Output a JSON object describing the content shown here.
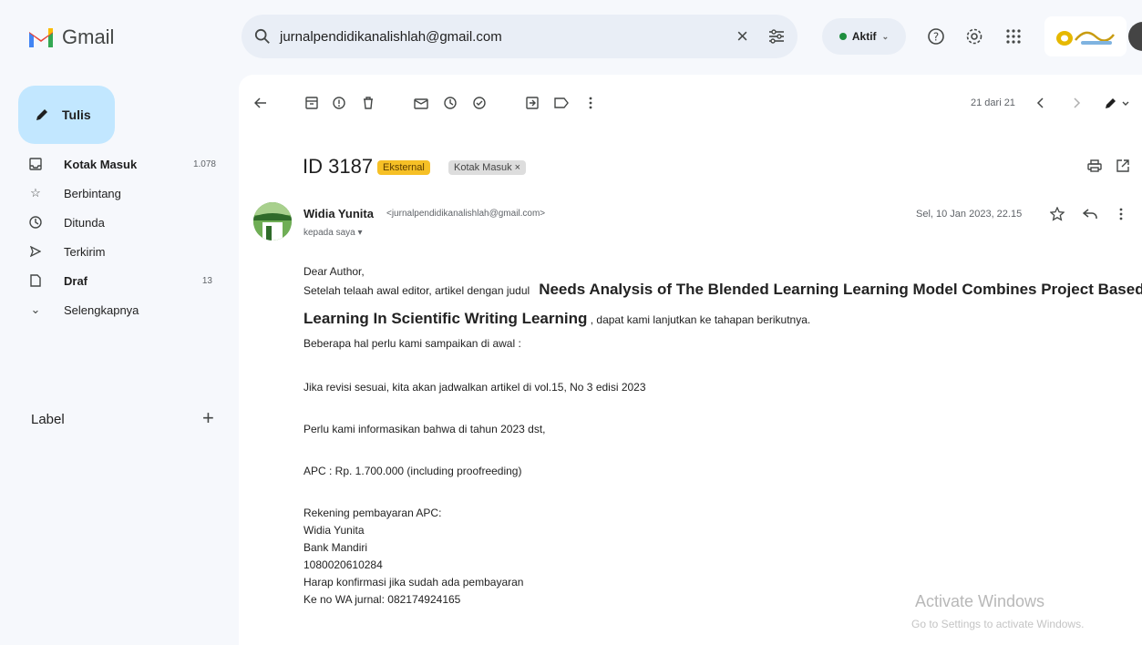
{
  "app": {
    "name": "Gmail"
  },
  "search": {
    "value": "jurnalpendidikanalishlah@gmail.com"
  },
  "status": {
    "label": "Aktif"
  },
  "compose": {
    "label": "Tulis"
  },
  "sidebar": {
    "items": [
      {
        "label": "Kotak Masuk",
        "count": "1.078"
      },
      {
        "label": "Berbintang",
        "count": ""
      },
      {
        "label": "Ditunda",
        "count": ""
      },
      {
        "label": "Terkirim",
        "count": ""
      },
      {
        "label": "Draf",
        "count": "13"
      },
      {
        "label": "Selengkapnya",
        "count": ""
      }
    ],
    "label_heading": "Label"
  },
  "toolbar": {
    "pager": "21 dari 21"
  },
  "email": {
    "subject": "ID 3187",
    "chips": {
      "external": "Eksternal",
      "inbox": "Kotak Masuk ×"
    },
    "sender_name": "Widia Yunita",
    "sender_email": "<jurnalpendidikanalishlah@gmail.com>",
    "to": "kepada saya ▾",
    "date": "Sel, 10 Jan 2023, 22.15",
    "body": {
      "greeting": "Dear Author,",
      "line1_prefix": "Setelah telaah awal editor, artikel dengan judul",
      "title_part1": "Needs Analysis  of The Blended Learning Learning Model Combines Project Based",
      "title_part2": "Learning In Scientific Writing Learning",
      "line2_suffix": ",  dapat kami lanjutkan ke tahapan berikutnya.",
      "line3": "Beberapa hal perlu kami sampaikan di awal :",
      "line4": "Jika revisi sesuai, kita akan jadwalkan artikel  di vol.15, No 3 edisi   2023",
      "line5": "Perlu kami informasikan bahwa di tahun 2023 dst,",
      "line6": "APC  : Rp. 1.700.000 (including proofreeding)",
      "line7": "Rekening pembayaran APC:",
      "line8": "Widia Yunita",
      "line9": "Bank Mandiri",
      "line10": "1080020610284",
      "line11": "Harap konfirmasi jika sudah ada pembayaran",
      "line12": "Ke no WA jurnal: 082174924165"
    }
  },
  "watermark": {
    "line1": "Activate Windows",
    "line2": "Go to Settings to activate Windows."
  },
  "colors": {
    "compose_bg": "#c2e7ff",
    "external_chip": "#f6c026",
    "status_dot": "#1e8e3e"
  }
}
